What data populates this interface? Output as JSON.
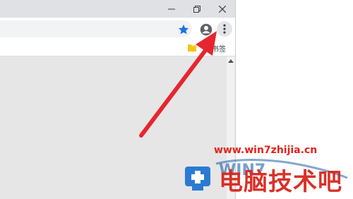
{
  "window_controls": {
    "minimize_icon": "minimize-icon",
    "restore_icon": "restore-icon",
    "close_icon": "close-icon"
  },
  "toolbar": {
    "bookmark_star_icon": "star-icon",
    "profile_icon": "account-circle-icon",
    "menu_icon": "more-vert-icon"
  },
  "bookmarks_bar": {
    "folder_icon": "folder-icon",
    "label": "书签"
  },
  "annotation": {
    "arrow_color": "#e6262e"
  },
  "watermark": {
    "url": "www.win7zhijia.cn",
    "text": "电脑技术吧",
    "logo_text": "WIN7"
  },
  "colors": {
    "accent_blue": "#1a73e8",
    "watermark_red": "#e2231a"
  }
}
